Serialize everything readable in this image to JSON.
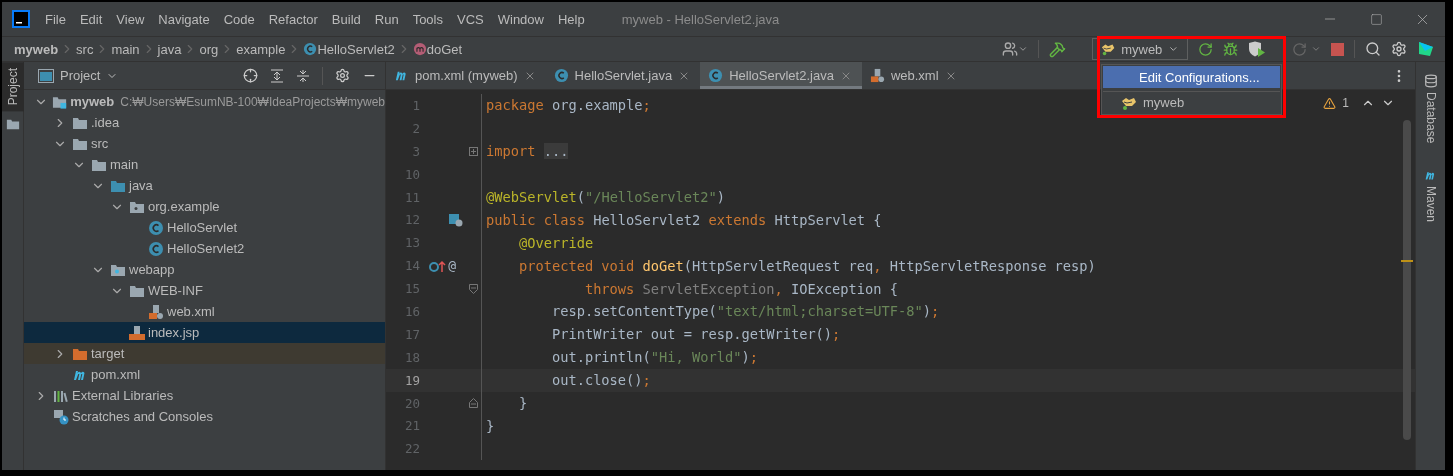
{
  "window": {
    "title": "myweb - HelloServlet2.java"
  },
  "menu": [
    "File",
    "Edit",
    "View",
    "Navigate",
    "Code",
    "Refactor",
    "Build",
    "Run",
    "Tools",
    "VCS",
    "Window",
    "Help"
  ],
  "breadcrumbs": [
    {
      "label": "myweb",
      "kind": "project"
    },
    {
      "label": "src",
      "kind": "dir"
    },
    {
      "label": "main",
      "kind": "dir"
    },
    {
      "label": "java",
      "kind": "dir"
    },
    {
      "label": "org",
      "kind": "dir"
    },
    {
      "label": "example",
      "kind": "dir"
    },
    {
      "label": "HelloServlet2",
      "kind": "class"
    },
    {
      "label": "doGet",
      "kind": "method"
    }
  ],
  "run_config": {
    "label": "myweb",
    "highlighted": true,
    "menu": [
      {
        "label": "Edit Configurations...",
        "selected": true,
        "kind": "action"
      },
      {
        "label": "myweb",
        "selected": false,
        "kind": "config"
      }
    ]
  },
  "left_strip": [
    {
      "label": "Project",
      "selected": true
    }
  ],
  "project_panel": {
    "title": "Project",
    "tree": [
      {
        "label": "myweb",
        "hint": "C:₩Users₩EsumNB-100₩IdeaProjects₩myweb",
        "kind": "module",
        "expanded": true,
        "selected": false,
        "children": [
          {
            "label": ".idea",
            "kind": "folder",
            "expanded": false,
            "selected": false
          },
          {
            "label": "src",
            "kind": "folder",
            "expanded": true,
            "selected": false,
            "children": [
              {
                "label": "main",
                "kind": "folder",
                "expanded": true,
                "selected": false,
                "children": [
                  {
                    "label": "java",
                    "kind": "source",
                    "expanded": true,
                    "selected": false,
                    "children": [
                      {
                        "label": "org.example",
                        "kind": "package",
                        "expanded": true,
                        "selected": false,
                        "children": [
                          {
                            "label": "HelloServlet",
                            "kind": "class",
                            "selected": false
                          },
                          {
                            "label": "HelloServlet2",
                            "kind": "class",
                            "selected": false
                          }
                        ]
                      }
                    ]
                  },
                  {
                    "label": "webapp",
                    "kind": "web",
                    "expanded": true,
                    "selected": false,
                    "children": [
                      {
                        "label": "WEB-INF",
                        "kind": "folder",
                        "expanded": true,
                        "selected": false,
                        "children": [
                          {
                            "label": "web.xml",
                            "kind": "xml",
                            "selected": false
                          }
                        ]
                      },
                      {
                        "label": "index.jsp",
                        "kind": "jsp",
                        "selected": true
                      }
                    ]
                  }
                ]
              }
            ]
          },
          {
            "label": "target",
            "kind": "excluded",
            "expanded": false,
            "selected": false
          },
          {
            "label": "pom.xml",
            "kind": "maven",
            "selected": false
          }
        ]
      },
      {
        "label": "External Libraries",
        "kind": "libraries",
        "expanded": false,
        "selected": false
      },
      {
        "label": "Scratches and Consoles",
        "kind": "scratches",
        "selected": false
      }
    ]
  },
  "editor": {
    "tabs": [
      {
        "label": "pom.xml (myweb)",
        "kind": "maven",
        "selected": false
      },
      {
        "label": "HelloServlet.java",
        "kind": "class",
        "selected": false
      },
      {
        "label": "HelloServlet2.java",
        "kind": "class",
        "selected": true
      },
      {
        "label": "web.xml",
        "kind": "xml",
        "selected": false
      }
    ],
    "warnings": "1",
    "lines": [
      {
        "n": "1",
        "current": false,
        "tokens": [
          {
            "kind": "kw",
            "text": "package "
          },
          {
            "kind": "plain",
            "text": "org.example"
          },
          {
            "kind": "punct",
            "text": ";"
          }
        ]
      },
      {
        "n": "2",
        "current": false
      },
      {
        "n": "3",
        "current": false,
        "fold": {
          "kind": "collapsed"
        },
        "tokens": [
          {
            "kind": "kw",
            "text": "import "
          },
          {
            "kind": "folded",
            "text": "..."
          }
        ]
      },
      {
        "n": "10",
        "current": false
      },
      {
        "n": "11",
        "current": false,
        "tokens": [
          {
            "kind": "anno",
            "text": "@WebServlet"
          },
          {
            "kind": "plain",
            "text": "("
          },
          {
            "kind": "str",
            "text": "\"/HelloServlet2\""
          },
          {
            "kind": "plain",
            "text": ")"
          }
        ]
      },
      {
        "n": "12",
        "current": false,
        "gutter": {
          "kind": "servlet"
        },
        "tokens": [
          {
            "kind": "kw",
            "text": "public class "
          },
          {
            "kind": "plain",
            "text": "HelloServlet2 "
          },
          {
            "kind": "kw",
            "text": "extends "
          },
          {
            "kind": "plain",
            "text": "HttpServlet {"
          }
        ]
      },
      {
        "n": "13",
        "current": false,
        "tokens": [
          {
            "kind": "anno",
            "text": "    @Override"
          }
        ]
      },
      {
        "n": "14",
        "current": false,
        "gutter": {
          "kind": "override"
        },
        "gutter_text": "@",
        "tokens": [
          {
            "kind": "kw",
            "text": "    protected void "
          },
          {
            "kind": "method",
            "text": "doGet"
          },
          {
            "kind": "plain",
            "text": "(HttpServletRequest req"
          },
          {
            "kind": "punct",
            "text": ", "
          },
          {
            "kind": "plain",
            "text": "HttpServletResponse resp)"
          }
        ]
      },
      {
        "n": "15",
        "current": false,
        "fold": {
          "kind": "start"
        },
        "tokens": [
          {
            "kind": "kw",
            "text": "            throws "
          },
          {
            "kind": "muted",
            "text": "ServletException"
          },
          {
            "kind": "punct",
            "text": ", "
          },
          {
            "kind": "plain",
            "text": "IOException {"
          }
        ]
      },
      {
        "n": "16",
        "current": false,
        "tokens": [
          {
            "kind": "plain",
            "text": "        resp.setContentType("
          },
          {
            "kind": "str",
            "text": "\"text/html;charset=UTF-8\""
          },
          {
            "kind": "plain",
            "text": ")"
          },
          {
            "kind": "punct",
            "text": ";"
          }
        ]
      },
      {
        "n": "17",
        "current": false,
        "tokens": [
          {
            "kind": "plain",
            "text": "        PrintWriter out = resp.getWriter()"
          },
          {
            "kind": "punct",
            "text": ";"
          }
        ]
      },
      {
        "n": "18",
        "current": false,
        "tokens": [
          {
            "kind": "plain",
            "text": "        out.println("
          },
          {
            "kind": "str",
            "text": "\"Hi, World\""
          },
          {
            "kind": "plain",
            "text": ")"
          },
          {
            "kind": "punct",
            "text": ";"
          }
        ]
      },
      {
        "n": "19",
        "current": true,
        "tokens": [
          {
            "kind": "plain",
            "text": "        out.close()"
          },
          {
            "kind": "punct",
            "text": ";"
          }
        ]
      },
      {
        "n": "20",
        "current": false,
        "fold": {
          "kind": "end"
        },
        "tokens": [
          {
            "kind": "plain",
            "text": "    }"
          }
        ]
      },
      {
        "n": "21",
        "current": false,
        "tokens": [
          {
            "kind": "plain",
            "text": "}"
          }
        ]
      },
      {
        "n": "22",
        "current": false
      }
    ]
  },
  "right_strip": [
    {
      "label": "Database",
      "kind": "database"
    },
    {
      "label": "Maven",
      "kind": "maven"
    }
  ]
}
